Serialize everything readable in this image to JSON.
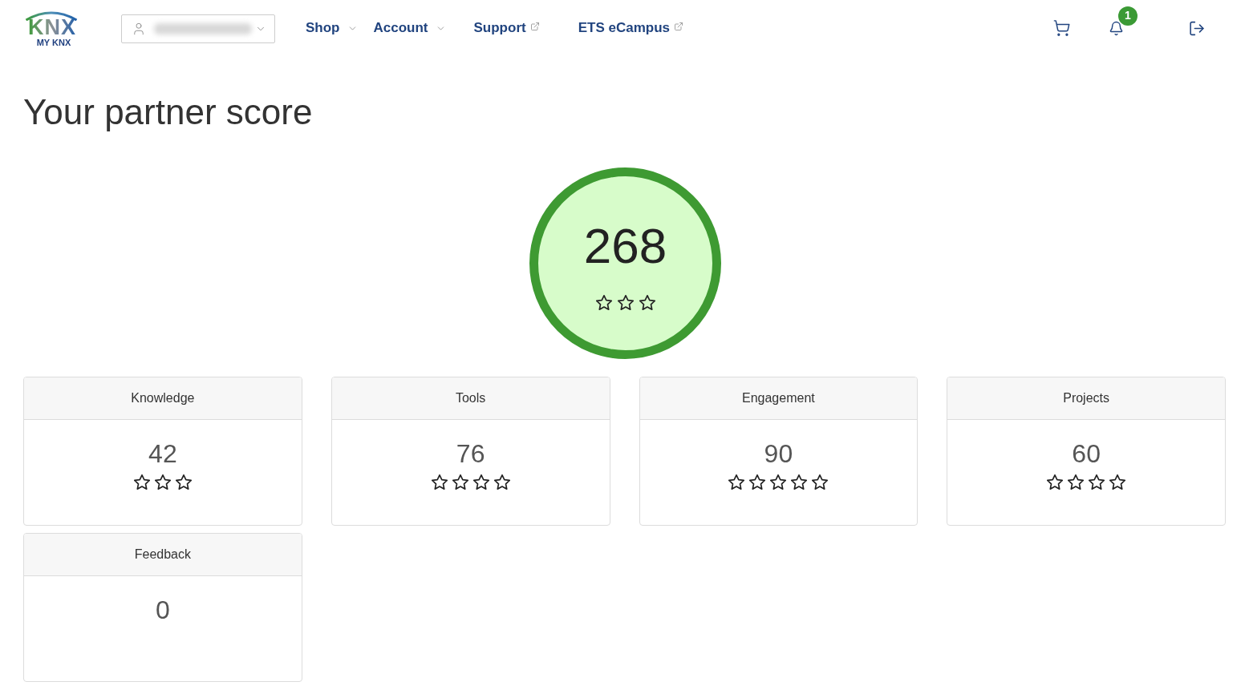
{
  "logo": {
    "wordmark": "KNX",
    "subtitle": "MY KNX"
  },
  "nav": [
    {
      "label": "Shop",
      "kind": "dropdown"
    },
    {
      "label": "Account",
      "kind": "dropdown"
    },
    {
      "label": "Support",
      "kind": "external"
    },
    {
      "label": "ETS eCampus",
      "kind": "external"
    }
  ],
  "notifications": {
    "badge": "1"
  },
  "title": "Your partner score",
  "total": {
    "score": "268",
    "star_slots": [
      {
        "filled": false
      },
      {
        "filled": false
      },
      {
        "filled": false
      }
    ]
  },
  "categories": [
    {
      "name": "Knowledge",
      "score": "42",
      "star_slots": [
        {
          "filled": false
        },
        {
          "filled": false
        },
        {
          "filled": false
        }
      ]
    },
    {
      "name": "Tools",
      "score": "76",
      "star_slots": [
        {
          "filled": false
        },
        {
          "filled": false
        },
        {
          "filled": false
        },
        {
          "filled": false
        }
      ]
    },
    {
      "name": "Engagement",
      "score": "90",
      "star_slots": [
        {
          "filled": false
        },
        {
          "filled": false
        },
        {
          "filled": false
        },
        {
          "filled": false
        },
        {
          "filled": false
        }
      ]
    },
    {
      "name": "Projects",
      "score": "60",
      "star_slots": [
        {
          "filled": false
        },
        {
          "filled": false
        },
        {
          "filled": false
        },
        {
          "filled": false
        }
      ]
    },
    {
      "name": "Feedback",
      "score": "0"
    }
  ]
}
